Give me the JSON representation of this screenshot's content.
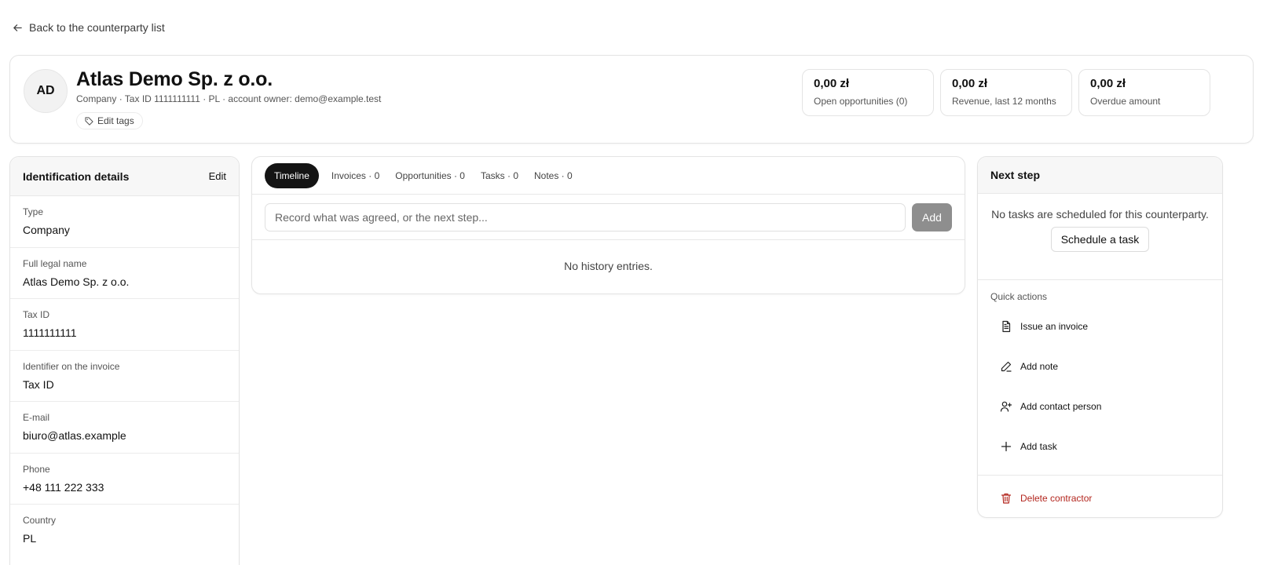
{
  "nav": {
    "back_label": "Back to the counterparty list"
  },
  "header": {
    "avatar_initials": "AD",
    "company_name": "Atlas Demo Sp. z o.o.",
    "meta": "Company · Tax ID 1111111111 · PL · account owner: demo@example.test",
    "edit_tags_label": "Edit tags",
    "kpis": [
      {
        "value": "0,00 zł",
        "label": "Open opportunities (0)"
      },
      {
        "value": "0,00 zł",
        "label": "Revenue, last 12 months"
      },
      {
        "value": "0,00 zł",
        "label": "Overdue amount"
      }
    ]
  },
  "identification": {
    "title": "Identification details",
    "edit_label": "Edit",
    "fields": [
      {
        "label": "Type",
        "value": "Company"
      },
      {
        "label": "Full legal name",
        "value": "Atlas Demo Sp. z o.o."
      },
      {
        "label": "Tax ID",
        "value": "1111111111"
      },
      {
        "label": "Identifier on the invoice",
        "value": "Tax ID"
      },
      {
        "label": "E-mail",
        "value": "biuro@atlas.example"
      },
      {
        "label": "Phone",
        "value": "+48 111 222 333"
      },
      {
        "label": "Country",
        "value": "PL"
      }
    ]
  },
  "timeline": {
    "tabs": [
      {
        "label": "Timeline",
        "active": true
      },
      {
        "label": "Invoices · 0"
      },
      {
        "label": "Opportunities · 0"
      },
      {
        "label": "Tasks · 0"
      },
      {
        "label": "Notes · 0"
      }
    ],
    "input_placeholder": "Record what was agreed, or the next step...",
    "input_value": "",
    "add_label": "Add",
    "empty_message": "No history entries."
  },
  "next_step": {
    "title": "Next step",
    "message": "No tasks are scheduled for this counterparty.",
    "schedule_label": "Schedule a task",
    "quick_actions_label": "Quick actions",
    "actions": [
      {
        "label": "Issue an invoice",
        "icon": "document-icon"
      },
      {
        "label": "Add note",
        "icon": "pencil-icon"
      },
      {
        "label": "Add contact person",
        "icon": "user-plus-icon"
      },
      {
        "label": "Add task",
        "icon": "plus-icon"
      }
    ],
    "delete_label": "Delete contractor",
    "delete_color": "#b3261e"
  }
}
